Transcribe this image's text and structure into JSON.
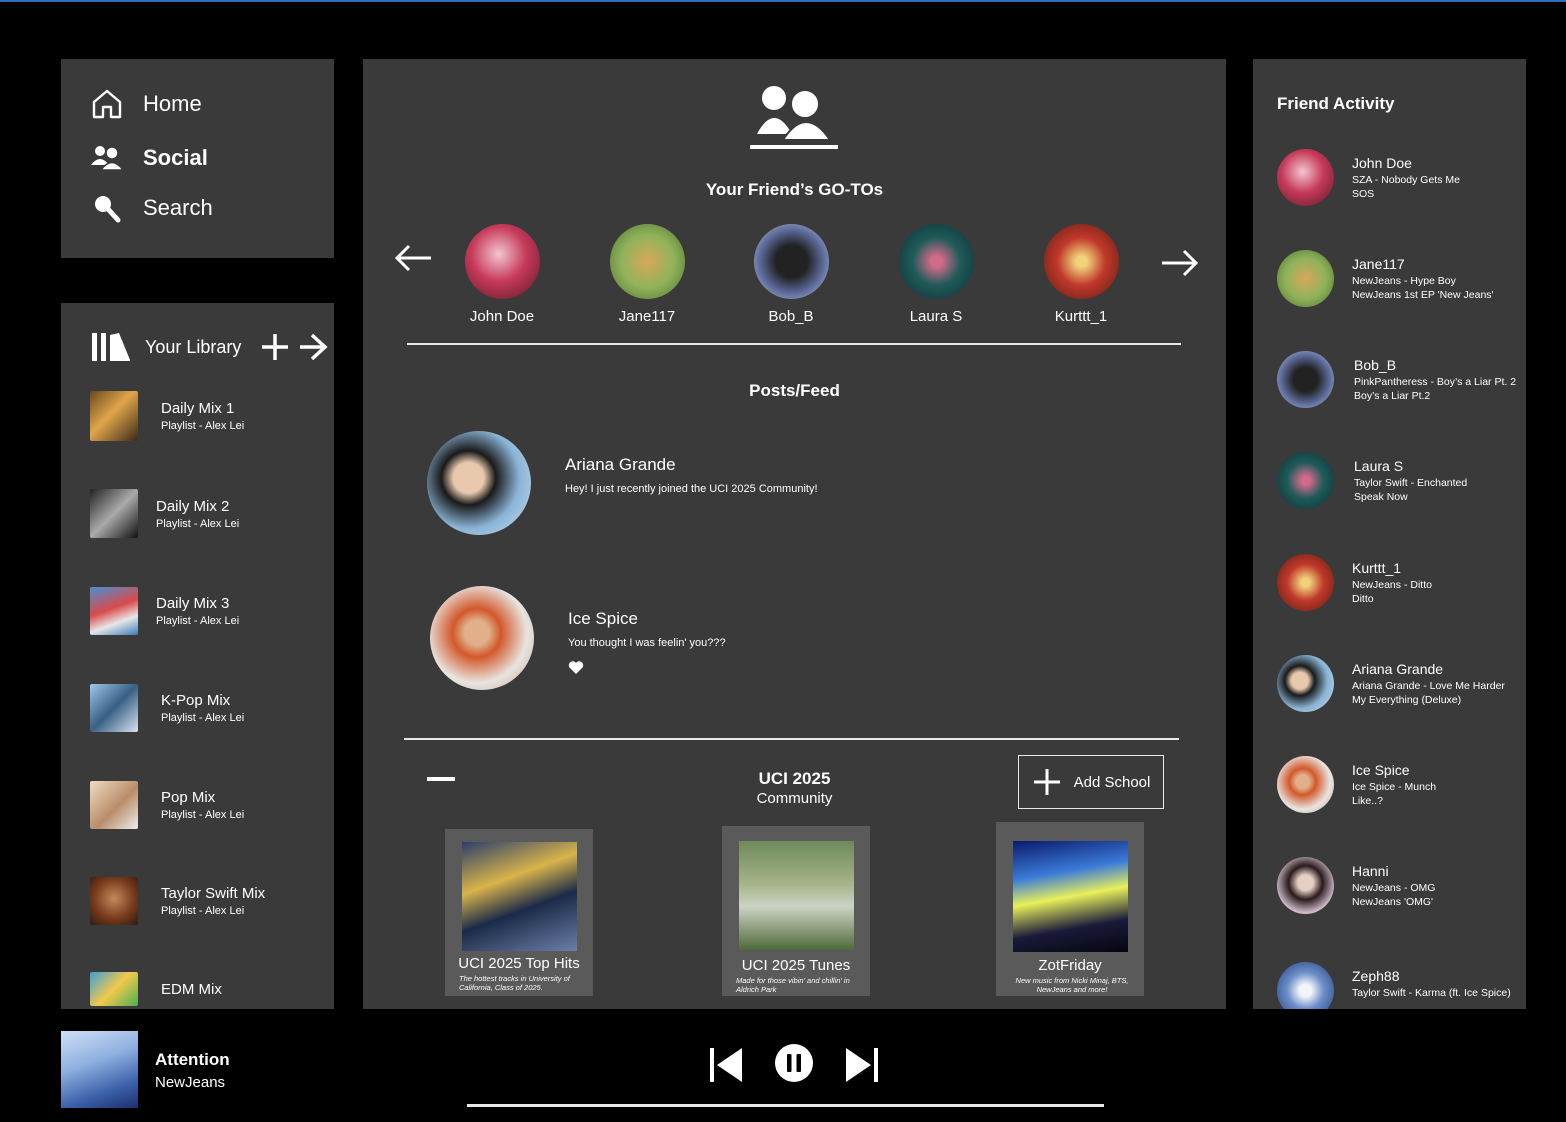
{
  "nav": {
    "items": [
      {
        "label": "Home",
        "icon": "home-icon"
      },
      {
        "label": "Social",
        "icon": "users-icon",
        "active": true
      },
      {
        "label": "Search",
        "icon": "search-icon"
      }
    ]
  },
  "library": {
    "title": "Your Library",
    "items": [
      {
        "title": "Daily Mix 1",
        "subtitle": "Playlist - Alex Lei"
      },
      {
        "title": "Daily Mix 2",
        "subtitle": "Playlist - Alex Lei"
      },
      {
        "title": "Daily Mix 3",
        "subtitle": "Playlist - Alex Lei"
      },
      {
        "title": "K-Pop Mix",
        "subtitle": "Playlist - Alex Lei"
      },
      {
        "title": "Pop Mix",
        "subtitle": "Playlist - Alex Lei"
      },
      {
        "title": "Taylor Swift Mix",
        "subtitle": "Playlist - Alex Lei"
      },
      {
        "title": "EDM Mix",
        "subtitle": ""
      }
    ]
  },
  "main": {
    "gotos_title": "Your Friend’s GO-TOs",
    "friends": [
      {
        "name": "John Doe"
      },
      {
        "name": "Jane117"
      },
      {
        "name": "Bob_B"
      },
      {
        "name": "Laura S"
      },
      {
        "name": "Kurttt_1"
      }
    ],
    "feed_title": "Posts/Feed",
    "posts": [
      {
        "name": "Ariana Grande",
        "text": "Hey! I just recently joined the UCI 2025 Community!"
      },
      {
        "name": "Ice Spice",
        "text": "You thought I was feelin' you???"
      }
    ],
    "community": {
      "title": "UCI 2025",
      "subtitle": "Community",
      "add_label": "Add School",
      "cards": [
        {
          "title": "UCI 2025 Top Hits",
          "desc": "The hottest tracks in University of California, Class of 2025."
        },
        {
          "title": "UCI 2025 Tunes",
          "desc": "Made for those vibin' and chillin' in Aldrich Park"
        },
        {
          "title": "ZotFriday",
          "desc": "New music from Nicki Minaj, BTS, NewJeans and more!"
        }
      ]
    }
  },
  "activity": {
    "title": "Friend Activity",
    "items": [
      {
        "name": "John Doe",
        "line1": "SZA - Nobody Gets Me",
        "line2": "SOS"
      },
      {
        "name": "Jane117",
        "line1": "NewJeans - Hype Boy",
        "line2": "NewJeans 1st EP 'New Jeans'"
      },
      {
        "name": "Bob_B",
        "line1": "PinkPantheress - Boy’s a Liar Pt. 2",
        "line2": "Boy’s a Liar Pt.2"
      },
      {
        "name": "Laura S",
        "line1": "Taylor Swift - Enchanted",
        "line2": "Speak Now"
      },
      {
        "name": "Kurttt_1",
        "line1": "NewJeans - Ditto",
        "line2": "Ditto"
      },
      {
        "name": "Ariana Grande",
        "line1": "Ariana Grande - Love Me Harder",
        "line2": "My Everything (Deluxe)"
      },
      {
        "name": "Ice Spice",
        "line1": "Ice Spice - Munch",
        "line2": "Like..?"
      },
      {
        "name": "Hanni",
        "line1": "NewJeans - OMG",
        "line2": "NewJeans 'OMG'"
      },
      {
        "name": "Zeph88",
        "line1": "Taylor Swift - Karma (ft. Ice Spice)",
        "line2": ""
      }
    ]
  },
  "player": {
    "title": "Attention",
    "artist": "NewJeans"
  }
}
